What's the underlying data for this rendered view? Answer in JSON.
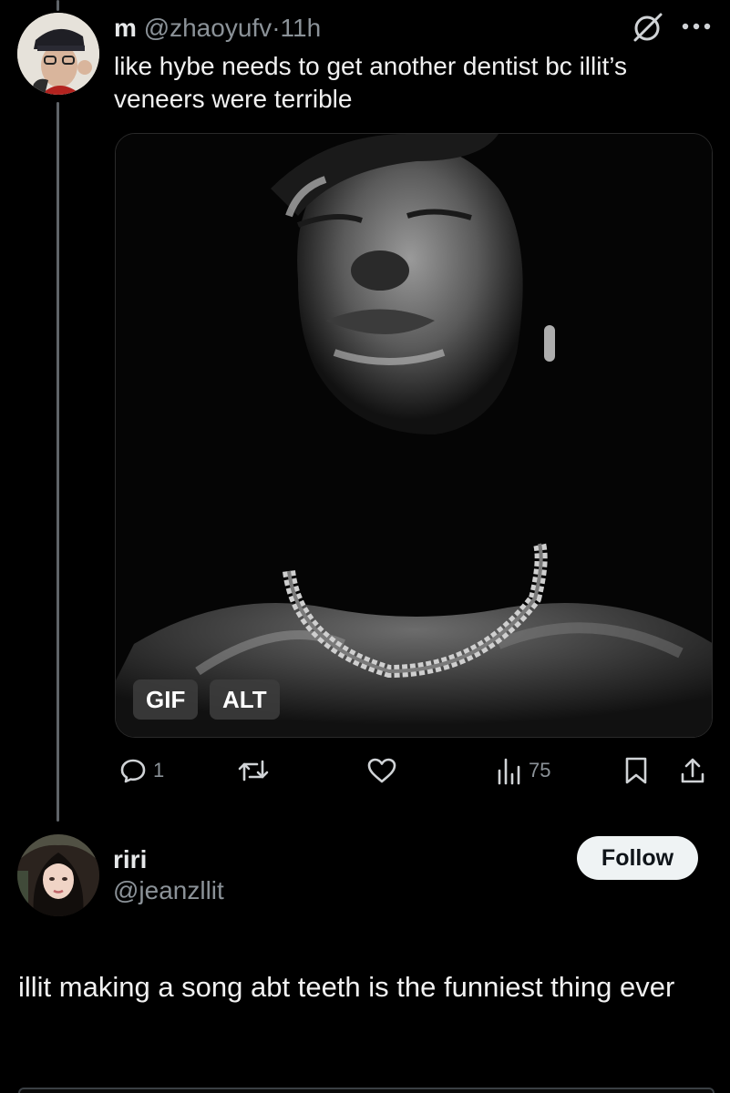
{
  "tweet1": {
    "name": "m",
    "handle": "@zhaoyufv",
    "separator": "·",
    "time": "11h",
    "text": "like hybe needs to get another dentist bc illit’s veneers were terrible",
    "media": {
      "badges": [
        "GIF",
        "ALT"
      ]
    },
    "actions": {
      "reply_count": "1",
      "repost_count": "",
      "like_count": "",
      "views_count": "75"
    }
  },
  "tweet2": {
    "name": "riri",
    "handle": "@jeanzllit",
    "follow_label": "Follow",
    "text": "illit making a song abt teeth is the funniest thing ever"
  },
  "icons": {
    "grok": "grok-icon",
    "more": "more-dots-icon",
    "reply": "reply-bubble-icon",
    "repost": "repost-icon",
    "like": "heart-icon",
    "views": "views-bars-icon",
    "bookmark": "bookmark-icon",
    "share": "share-icon"
  },
  "colors": {
    "background": "#000000",
    "text": "#e7e9ea",
    "muted": "#8b9298",
    "follow_bg": "#eff3f4"
  }
}
